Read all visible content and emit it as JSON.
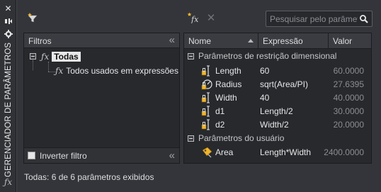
{
  "palette": {
    "title": "GERENCIADOR DE PARÂMETROS"
  },
  "toolbar": {
    "search_placeholder": "Pesquisar pelo parâmetro"
  },
  "filters": {
    "title": "Filtros",
    "tree": {
      "root": "Todas",
      "child": "Todos usados em expressões"
    },
    "invert_label": "Inverter filtro"
  },
  "grid": {
    "columns": {
      "name": "Nome",
      "expression": "Expressão",
      "value": "Valor"
    },
    "groups": [
      {
        "label": "Parâmetros de restrição dimensional",
        "rows": [
          {
            "name": "Length",
            "expression": "60",
            "value": "60.0000",
            "icon": "linear-dimension-icon"
          },
          {
            "name": "Radius",
            "expression": "sqrt(Area/PI)",
            "value": "27.6395",
            "icon": "radial-dimension-icon"
          },
          {
            "name": "Width",
            "expression": "40",
            "value": "40.0000",
            "icon": "linear-dimension-icon"
          },
          {
            "name": "d1",
            "expression": "Length/2",
            "value": "30.0000",
            "icon": "linear-dimension-icon"
          },
          {
            "name": "d2",
            "expression": "Width/2",
            "value": "20.0000",
            "icon": "linear-dimension-icon"
          }
        ]
      },
      {
        "label": "Parâmetros do usuário",
        "rows": [
          {
            "name": "Area",
            "expression": "Length*Width",
            "value": "2400.0000",
            "icon": "user-parameter-icon"
          }
        ]
      }
    ]
  },
  "status": "Todas: 6 de 6 parâmetros exibidos"
}
